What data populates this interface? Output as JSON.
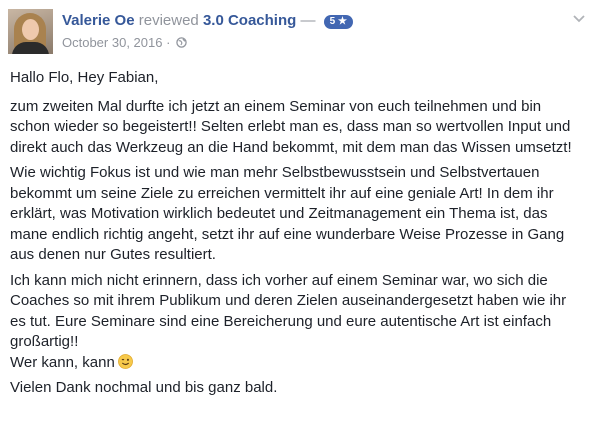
{
  "review": {
    "author": "Valerie Oe",
    "verb": "reviewed",
    "page_name": "3.0 Coaching",
    "separator": "—",
    "rating": "5 ★",
    "date": "October 30, 2016",
    "date_separator": "·",
    "privacy_icon": "globe-icon",
    "options_icon": "chevron-down-icon"
  },
  "body": {
    "greeting": "Hallo Flo, Hey Fabian,",
    "p1": "zum zweiten Mal durfte ich jetzt an einem Seminar von euch teilnehmen und bin schon wieder so begeistert!! Selten erlebt man es, dass man so wertvollen Input und direkt auch das Werkzeug an die Hand bekommt, mit dem man das Wissen umsetzt!",
    "p2": "Wie wichtig Fokus ist und wie man mehr Selbstbewusstsein und Selbstvertauen bekommt um seine Ziele zu erreichen vermittelt ihr auf eine geniale Art! In dem ihr erklärt, was Motivation wirklich bedeutet und Zeitmanagement ein Thema ist, das mane endlich richtig angeht, setzt ihr auf eine wunderbare Weise Prozesse in Gang aus denen nur Gutes resultiert.",
    "p3": "Ich kann mich nicht erinnern, dass ich vorher auf einem Seminar war, wo sich die Coaches so mit ihrem Publikum und deren Zielen auseinandergesetzt haben wie ihr es tut. Eure Seminare sind eine Bereicherung und eure autentische Art ist einfach großartig!!",
    "p4": "Wer kann, kann",
    "p4_emoji": "wink-emoji",
    "p5": "Vielen Dank nochmal und bis ganz bald."
  },
  "colors": {
    "link": "#365899",
    "meta": "#90949c",
    "badge": "#4267b2",
    "text": "#1d2129"
  }
}
